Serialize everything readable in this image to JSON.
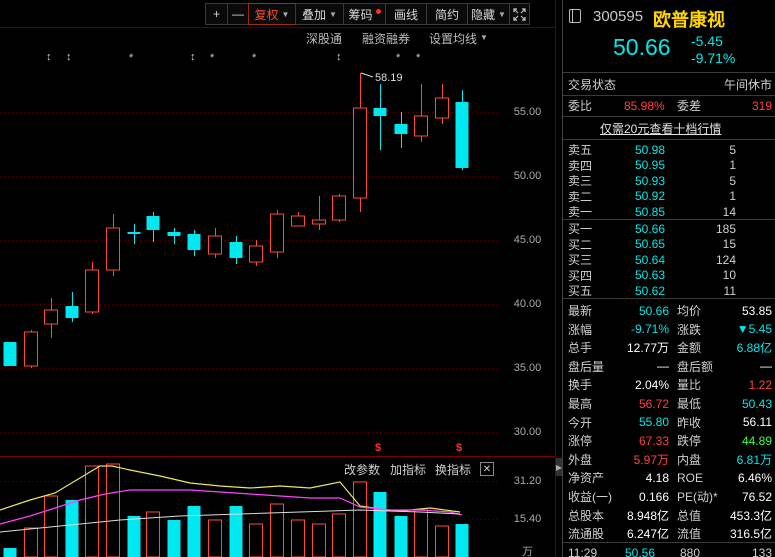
{
  "toolbar": {
    "plus": "+",
    "minus": "—",
    "fuquan": "复权",
    "diejia": "叠加",
    "chouma": "筹码",
    "huaxian": "画线",
    "jiancao": "简约",
    "yincang": "隐藏"
  },
  "subbar": {
    "shengutong": "深股通",
    "rongzi": "融资融券",
    "junxian": "设置均线"
  },
  "price_axis": [
    "55.00",
    "50.00",
    "45.00",
    "40.00",
    "35.00",
    "30.00"
  ],
  "max_label": "58.19",
  "indicator_bar": {
    "change_param": "改参数",
    "add_ind": "加指标",
    "switch_ind": "换指标",
    "close": "✕"
  },
  "vol_axis": [
    "31.20",
    "15.40",
    "万"
  ],
  "quote": {
    "code": "300595",
    "name": "欧普康视",
    "price": "50.66",
    "change": "-5.45",
    "change_pct": "-9.71%",
    "status_label": "交易状态",
    "status_value": "午间休市",
    "weibi_label": "委比",
    "weibi_value": "85.98%",
    "weicha_label": "委差",
    "weicha_value": "319",
    "promo": "仅需20元查看十档行情",
    "asks": [
      {
        "label": "卖五",
        "price": "50.98",
        "vol": "5"
      },
      {
        "label": "卖四",
        "price": "50.95",
        "vol": "1"
      },
      {
        "label": "卖三",
        "price": "50.93",
        "vol": "5"
      },
      {
        "label": "卖二",
        "price": "50.92",
        "vol": "1"
      },
      {
        "label": "卖一",
        "price": "50.85",
        "vol": "14"
      }
    ],
    "bids": [
      {
        "label": "买一",
        "price": "50.66",
        "vol": "185"
      },
      {
        "label": "买二",
        "price": "50.65",
        "vol": "15"
      },
      {
        "label": "买三",
        "price": "50.64",
        "vol": "124"
      },
      {
        "label": "买四",
        "price": "50.63",
        "vol": "10"
      },
      {
        "label": "买五",
        "price": "50.62",
        "vol": "11"
      }
    ],
    "stats": [
      {
        "l1": "最新",
        "v1": "50.66",
        "c1": "cy",
        "l2": "均价",
        "v2": "53.85",
        "c2": "wh"
      },
      {
        "l1": "涨幅",
        "v1": "-9.71%",
        "c1": "cy",
        "l2": "涨跌",
        "v2": "▼5.45",
        "c2": "cy"
      },
      {
        "l1": "总手",
        "v1": "12.77万",
        "c1": "wh",
        "l2": "金额",
        "v2": "6.88亿",
        "c2": "cy"
      },
      {
        "l1": "盘后量",
        "v1": "—",
        "c1": "wh",
        "l2": "盘后额",
        "v2": "—",
        "c2": "wh"
      },
      {
        "l1": "换手",
        "v1": "2.04%",
        "c1": "wh",
        "l2": "量比",
        "v2": "1.22",
        "c2": "rd"
      },
      {
        "l1": "最高",
        "v1": "56.72",
        "c1": "rd",
        "l2": "最低",
        "v2": "50.43",
        "c2": "cy"
      },
      {
        "l1": "今开",
        "v1": "55.80",
        "c1": "cy",
        "l2": "昨收",
        "v2": "56.11",
        "c2": "wh"
      },
      {
        "l1": "涨停",
        "v1": "67.33",
        "c1": "rd",
        "l2": "跌停",
        "v2": "44.89",
        "c2": "gr"
      },
      {
        "l1": "外盘",
        "v1": "5.97万",
        "c1": "rd",
        "l2": "内盘",
        "v2": "6.81万",
        "c2": "cy"
      },
      {
        "l1": "净资产",
        "v1": "4.18",
        "c1": "wh",
        "l2": "ROE",
        "v2": "6.46%",
        "c2": "wh"
      },
      {
        "l1": "收益(一)",
        "v1": "0.166",
        "c1": "wh",
        "l2": "PE(动)*",
        "v2": "76.52",
        "c2": "wh"
      },
      {
        "l1": "总股本",
        "v1": "8.948亿",
        "c1": "wh",
        "l2": "总值",
        "v2": "453.3亿",
        "c2": "wh"
      },
      {
        "l1": "流通股",
        "v1": "6.247亿",
        "c1": "wh",
        "l2": "流值",
        "v2": "316.5亿",
        "c2": "wh"
      }
    ],
    "tick": {
      "time": "11:29",
      "price": "50.56",
      "vol": "880",
      "num": "133"
    }
  },
  "colors": {
    "up": "#ff4a3a",
    "down": "#00e8f0",
    "bg": "#000000"
  }
}
